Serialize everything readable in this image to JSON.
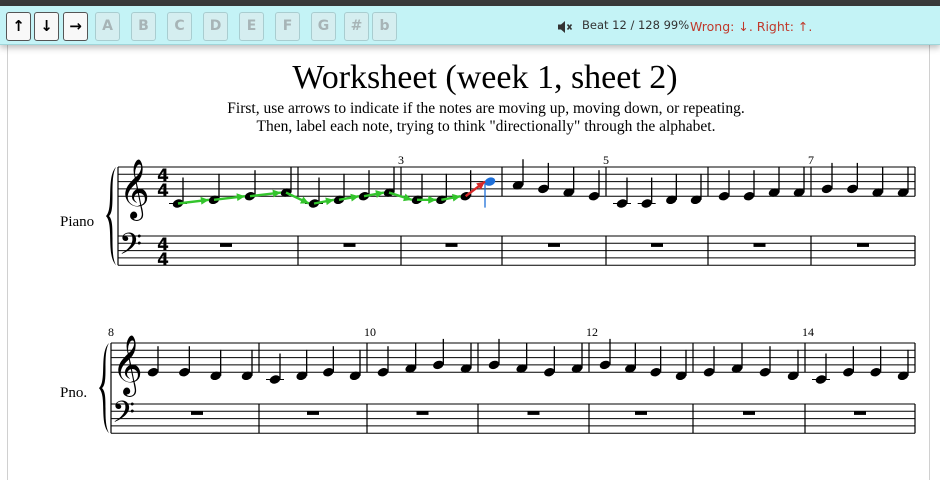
{
  "toolbar": {
    "buttons": [
      {
        "label": "↑",
        "name": "up-arrow-button",
        "enabled": true
      },
      {
        "label": "↓",
        "name": "down-arrow-button",
        "enabled": true
      },
      {
        "label": "→",
        "name": "repeat-arrow-button",
        "enabled": true
      },
      {
        "label": "A",
        "name": "note-a-button",
        "enabled": false
      },
      {
        "label": "B",
        "name": "note-b-button",
        "enabled": false
      },
      {
        "label": "C",
        "name": "note-c-button",
        "enabled": false
      },
      {
        "label": "D",
        "name": "note-d-button",
        "enabled": false
      },
      {
        "label": "E",
        "name": "note-e-button",
        "enabled": false
      },
      {
        "label": "F",
        "name": "note-f-button",
        "enabled": false
      },
      {
        "label": "G",
        "name": "note-g-button",
        "enabled": false
      },
      {
        "label": "#",
        "name": "sharp-button",
        "enabled": false
      },
      {
        "label": "b",
        "name": "flat-button",
        "enabled": false
      }
    ],
    "sound_icon": "speaker-muted-icon",
    "beat_status": "Beat 12 / 128  99%",
    "answer_status": "Wrong: ↓. Right: ↑."
  },
  "sheet": {
    "title": "Worksheet (week 1, sheet 2)",
    "instruction_line1": "First, use arrows to indicate if the notes are moving up, moving down, or repeating.",
    "instruction_line2": "Then, label each note, trying to think \"directionally\" through the alphabet.",
    "instrument_full": "Piano",
    "instrument_short": "Pno.",
    "time_signature": {
      "beats": "4",
      "unit": "4"
    },
    "measure_numbers": [
      "3",
      "5",
      "7",
      "8",
      "10",
      "12",
      "14"
    ],
    "systems": [
      {
        "measures": [
          {
            "number": null,
            "notes": [
              "C4",
              "D4",
              "E4",
              "F4"
            ]
          },
          {
            "number": null,
            "notes": [
              "C4",
              "D4",
              "E4",
              "F4"
            ]
          },
          {
            "number": "3",
            "notes": [
              "D4",
              "D4",
              "E4",
              "B4"
            ]
          },
          {
            "number": null,
            "notes": [
              "A4",
              "G4",
              "F4",
              "E4"
            ]
          },
          {
            "number": "5",
            "notes": [
              "C4",
              "C4",
              "D4",
              "D4"
            ]
          },
          {
            "number": null,
            "notes": [
              "E4",
              "E4",
              "F4",
              "F4"
            ]
          },
          {
            "number": "7",
            "notes": [
              "G4",
              "G4",
              "F4",
              "F4"
            ]
          }
        ]
      },
      {
        "measures": [
          {
            "number": "8",
            "notes": [
              "E4",
              "E4",
              "D4",
              "D4"
            ]
          },
          {
            "number": null,
            "notes": [
              "C4",
              "D4",
              "E4",
              "D4"
            ]
          },
          {
            "number": "10",
            "notes": [
              "E4",
              "F4",
              "G4",
              "F4"
            ]
          },
          {
            "number": null,
            "notes": [
              "G4",
              "F4",
              "E4",
              "F4"
            ]
          },
          {
            "number": "12",
            "notes": [
              "G4",
              "F4",
              "E4",
              "D4"
            ]
          },
          {
            "number": null,
            "notes": [
              "E4",
              "F4",
              "E4",
              "D4"
            ]
          },
          {
            "number": "14",
            "notes": [
              "C4",
              "E4",
              "E4",
              "D4"
            ]
          }
        ]
      }
    ],
    "arrows": [
      {
        "note": 0,
        "kind": "correct"
      },
      {
        "note": 1,
        "kind": "correct"
      },
      {
        "note": 2,
        "kind": "correct"
      },
      {
        "note": 3,
        "kind": "correct"
      },
      {
        "note": 4,
        "kind": "correct"
      },
      {
        "note": 5,
        "kind": "correct"
      },
      {
        "note": 6,
        "kind": "correct"
      },
      {
        "note": 7,
        "kind": "correct"
      },
      {
        "note": 8,
        "kind": "correct"
      },
      {
        "note": 9,
        "kind": "correct"
      },
      {
        "note": 10,
        "kind": "wrong"
      }
    ],
    "current_note": 11,
    "colors": {
      "correct_arrow": "#33c42c",
      "wrong_arrow": "#d62828",
      "current_note": "#1e6fd9",
      "ink": "#000000",
      "toolbar_bg": "#c4f3f6",
      "status_text": "#c0392b"
    }
  }
}
